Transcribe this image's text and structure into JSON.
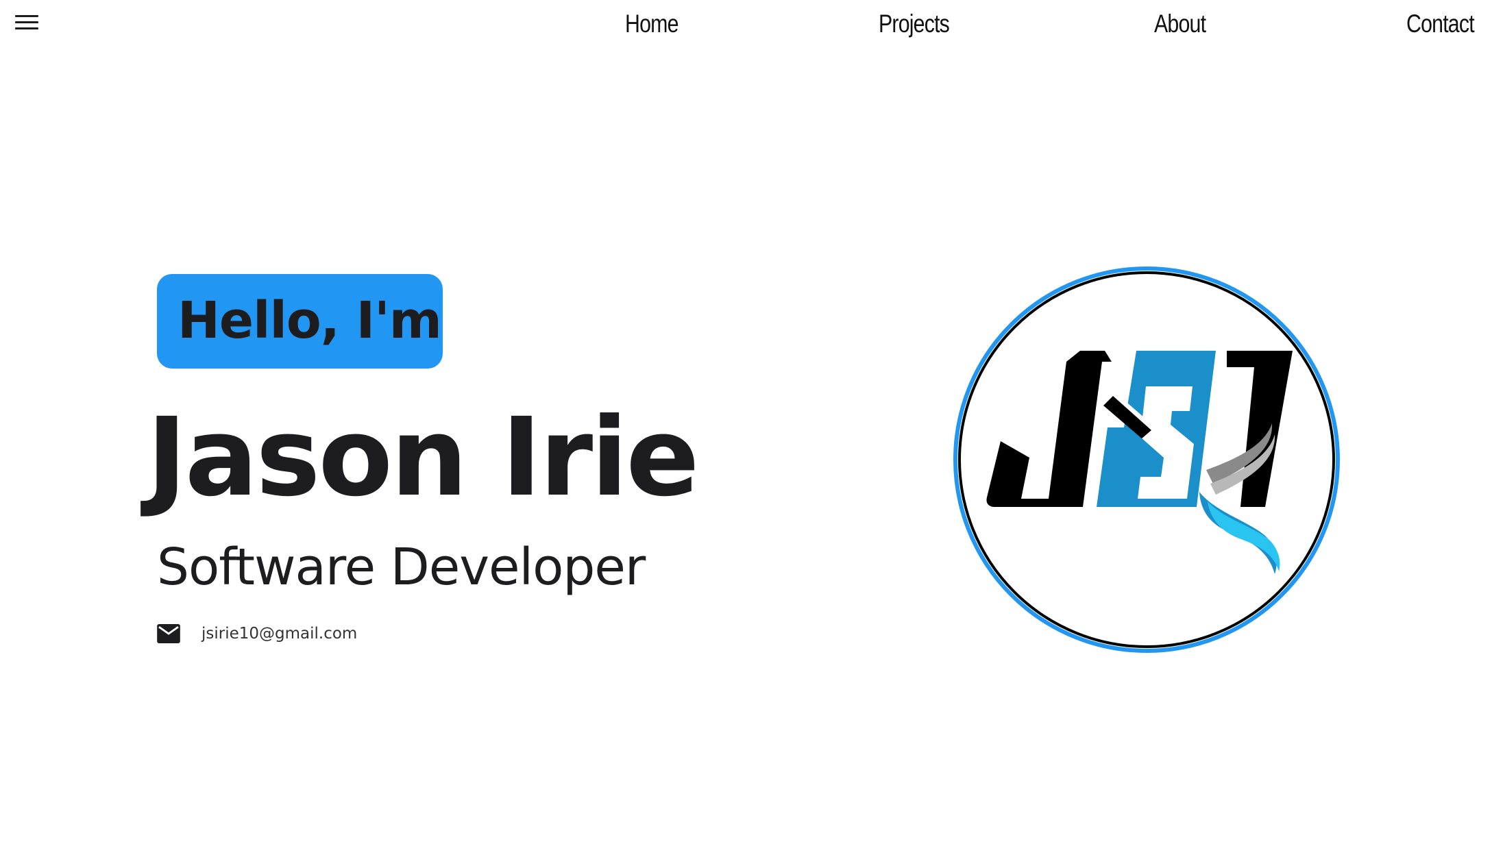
{
  "header": {
    "menu_icon": "hamburger-menu-icon",
    "nav": [
      {
        "label": "Home"
      },
      {
        "label": "Projects"
      },
      {
        "label": "About"
      },
      {
        "label": "Contact"
      }
    ]
  },
  "hero": {
    "greeting": "Hello, I'm",
    "name": "Jason Irie",
    "role": "Software Developer",
    "email_icon": "mail-icon",
    "email": "jsirie10@gmail.com",
    "logo_text": "JSI"
  },
  "colors": {
    "accent": "#2196f3",
    "logo_blue": "#1a8fc9",
    "text": "#1d1d1f"
  }
}
